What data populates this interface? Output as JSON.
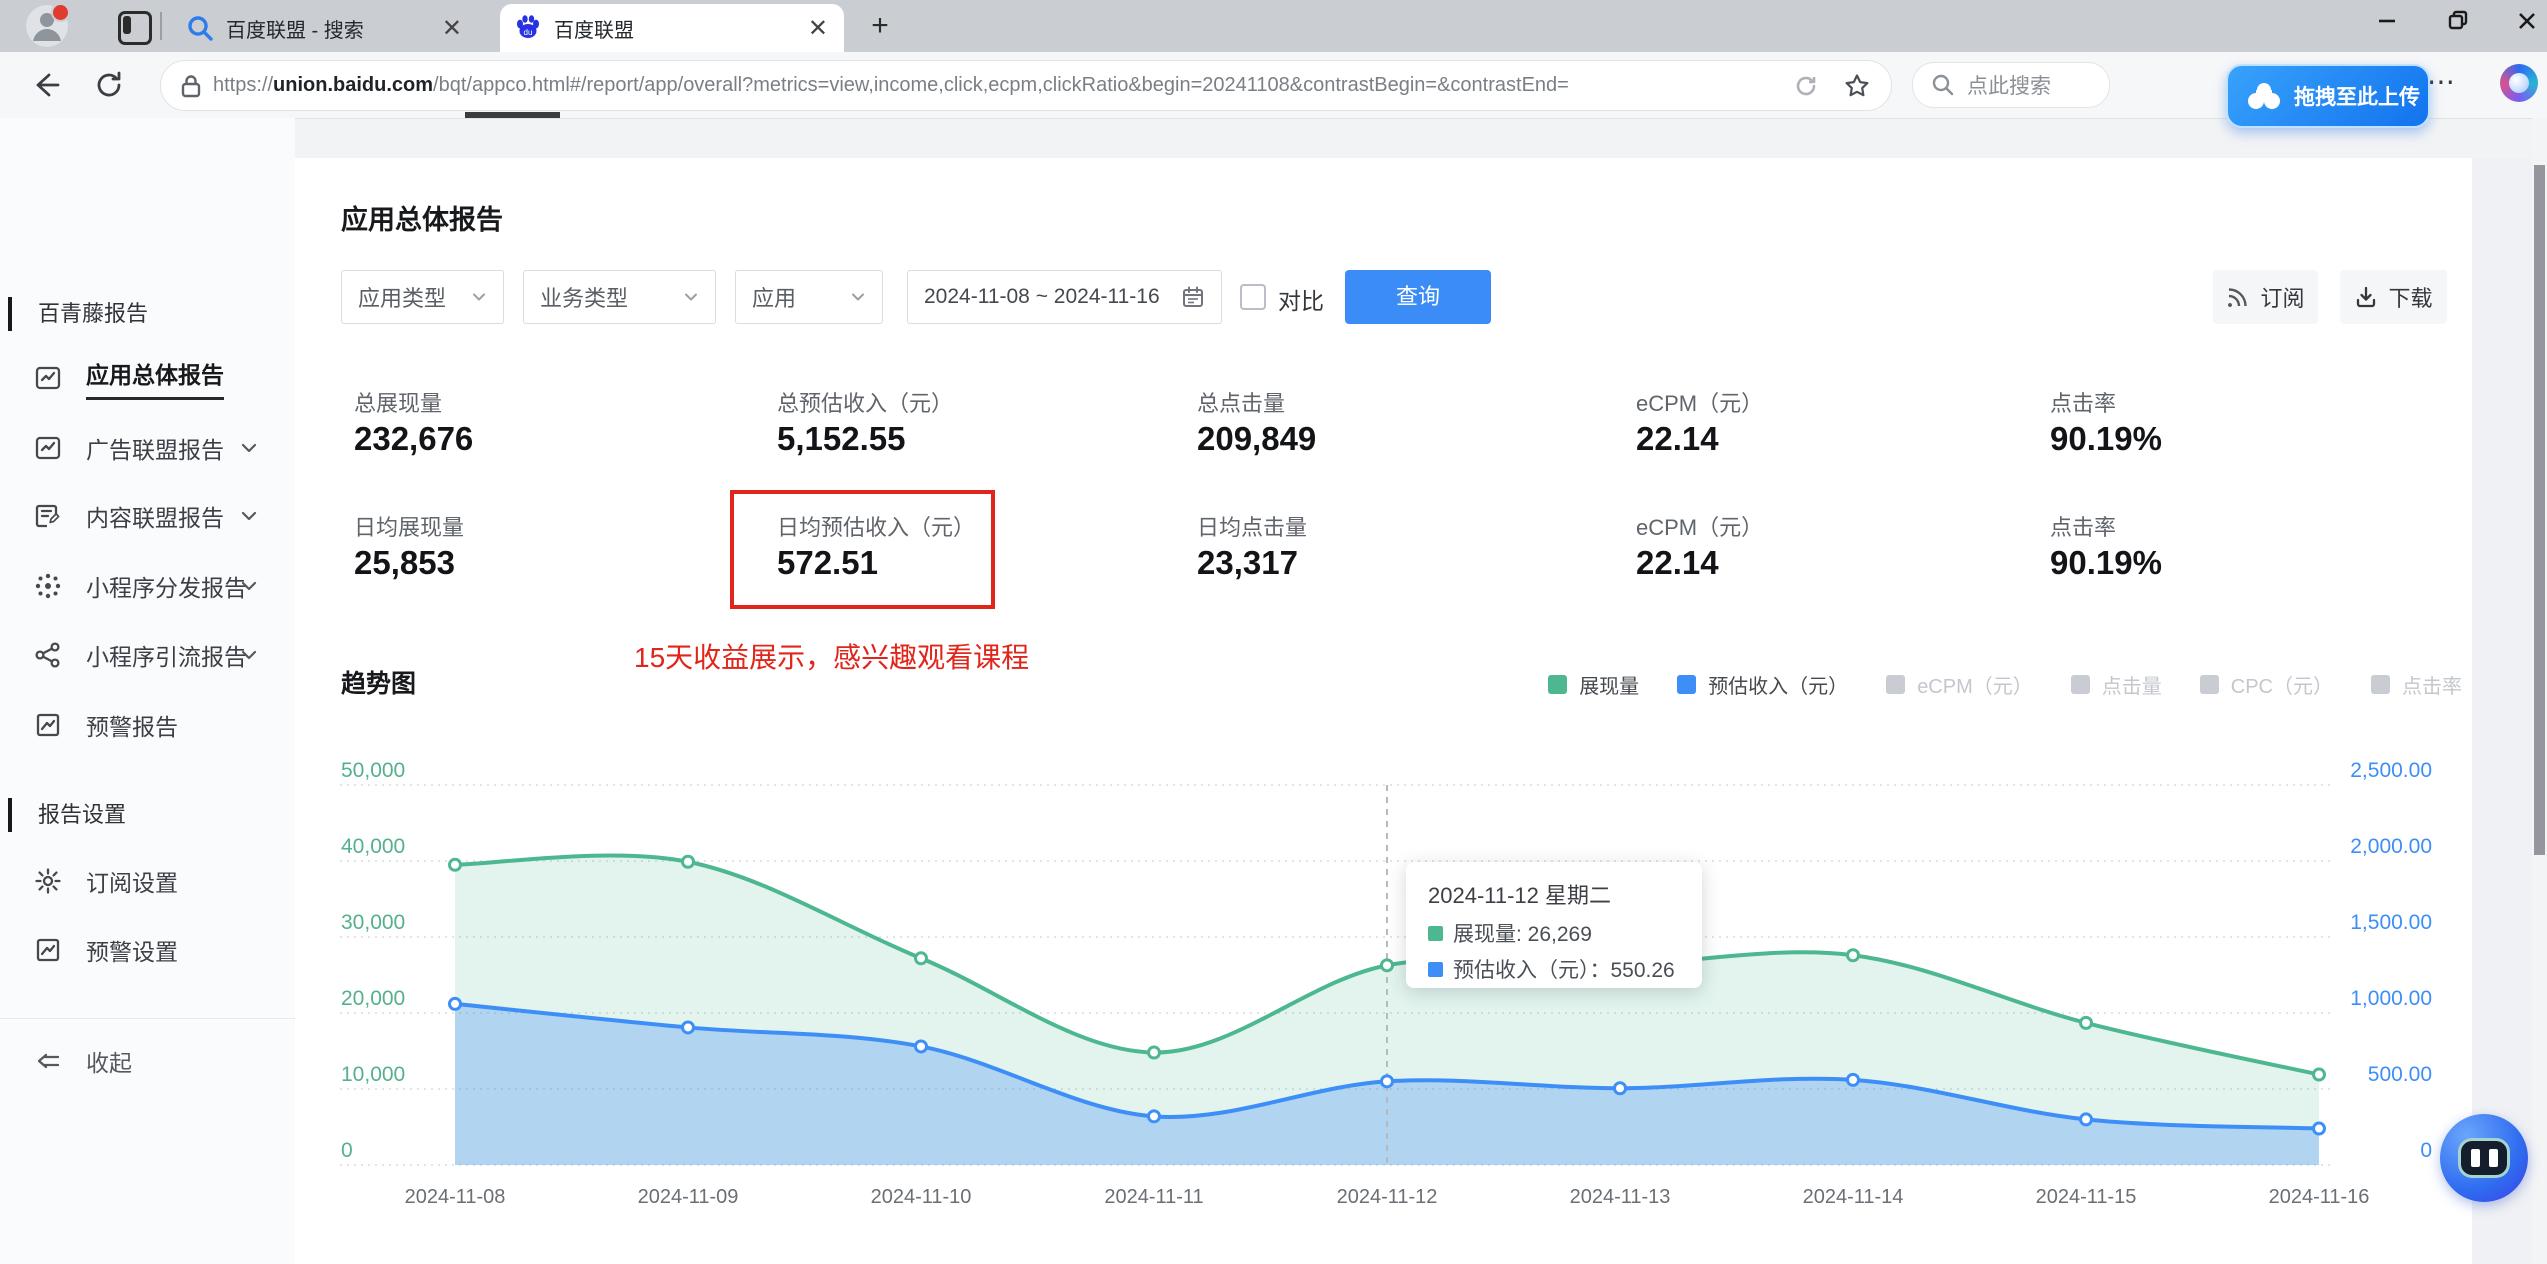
{
  "browser": {
    "tabs": [
      {
        "title": "百度联盟 - 搜索"
      },
      {
        "title": "百度联盟"
      }
    ],
    "icons": {
      "close_tab": "✕",
      "new_tab": "+",
      "more": "⋯"
    },
    "url": {
      "protocol": "https://",
      "domain": "union.baidu.com",
      "path": "/bqt/appco.html#/report/app/overall?metrics=view,income,click,ecpm,clickRatio&begin=20241108&contrastBegin=&contrastEnd="
    },
    "search_placeholder": "点此搜索",
    "netdisk_label": "拖拽至此上传"
  },
  "sidebar": {
    "section_reports": "百青藤报告",
    "items": [
      {
        "label": "应用总体报告",
        "active": true
      },
      {
        "label": "广告联盟报告"
      },
      {
        "label": "内容联盟报告"
      },
      {
        "label": "小程序分发报告"
      },
      {
        "label": "小程序引流报告"
      },
      {
        "label": "预警报告"
      }
    ],
    "section_settings": "报告设置",
    "settings": [
      {
        "label": "订阅设置"
      },
      {
        "label": "预警设置"
      }
    ],
    "collapse": "收起"
  },
  "main": {
    "title": "应用总体报告",
    "filters": {
      "app_type": "应用类型",
      "biz_type": "业务类型",
      "app": "应用",
      "date_range": "2024-11-08 ~ 2024-11-16",
      "contrast": "对比",
      "query": "查询"
    },
    "actions": {
      "subscribe": "订阅",
      "download": "下载"
    },
    "stats_row1": [
      {
        "label": "总展现量",
        "value": "232,676"
      },
      {
        "label": "总预估收入（元）",
        "value": "5,152.55"
      },
      {
        "label": "总点击量",
        "value": "209,849"
      },
      {
        "label": "eCPM（元）",
        "value": "22.14"
      },
      {
        "label": "点击率",
        "value": "90.19%"
      }
    ],
    "stats_row2": [
      {
        "label": "日均展现量",
        "value": "25,853"
      },
      {
        "label": "日均预估收入（元）",
        "value": "572.51"
      },
      {
        "label": "日均点击量",
        "value": "23,317"
      },
      {
        "label": "eCPM（元）",
        "value": "22.14"
      },
      {
        "label": "点击率",
        "value": "90.19%"
      }
    ],
    "annotation": "15天收益展示，感兴趣观看课程",
    "chart_title": "趋势图"
  },
  "chart_data": {
    "type": "area",
    "x": [
      "2024-11-08",
      "2024-11-09",
      "2024-11-10",
      "2024-11-11",
      "2024-11-12",
      "2024-11-13",
      "2024-11-14",
      "2024-11-15",
      "2024-11-16"
    ],
    "series": [
      {
        "name": "展现量",
        "axis": "left",
        "color": "#4db88f",
        "fill": "rgba(77,184,143,0.16)",
        "values": [
          39500,
          39900,
          27200,
          14800,
          26269,
          26400,
          27600,
          18700,
          11900
        ]
      },
      {
        "name": "预估收入（元）",
        "axis": "right",
        "color": "#3e8ef7",
        "fill": "rgba(62,142,247,0.30)",
        "values": [
          1060,
          905,
          780,
          320,
          550.26,
          505,
          560,
          300,
          240
        ]
      }
    ],
    "inactive_legend": [
      "eCPM（元）",
      "点击量",
      "CPC（元）",
      "点击率"
    ],
    "left_axis": {
      "range": [
        0,
        50000
      ],
      "ticks": [
        "50,000",
        "40,000",
        "30,000",
        "20,000",
        "10,000",
        "0"
      ]
    },
    "right_axis": {
      "range": [
        0,
        2500
      ],
      "ticks": [
        "2,500.00",
        "2,000.00",
        "1,500.00",
        "1,000.00",
        "500.00",
        "0"
      ]
    },
    "highlight_x": "2024-11-12",
    "legend_position": "top-right",
    "grid": "horizontal-dotted"
  },
  "tooltip": {
    "date": "2024-11-12 星期二",
    "rows": [
      {
        "color": "#4db88f",
        "text": "展现量: 26,269"
      },
      {
        "color": "#3e8ef7",
        "text": "预估收入（元）：550.26"
      }
    ]
  }
}
